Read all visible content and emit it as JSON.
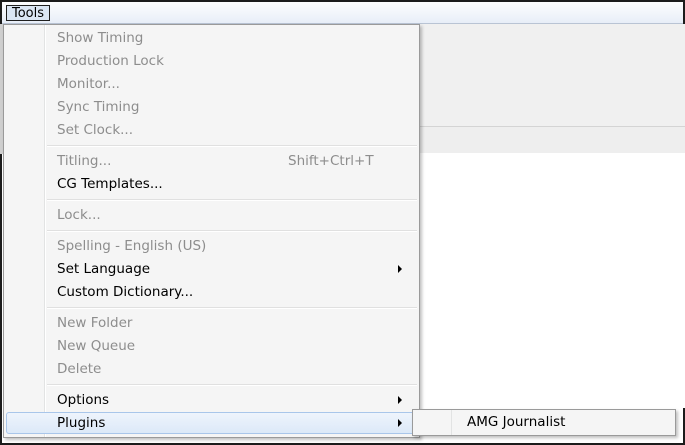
{
  "menubar": {
    "tools_label": "Tools"
  },
  "menu": {
    "show_timing": "Show Timing",
    "production_lock": "Production Lock",
    "monitor": "Monitor...",
    "sync_timing": "Sync Timing",
    "set_clock": "Set Clock...",
    "titling": "Titling...",
    "titling_shortcut": "Shift+Ctrl+T",
    "cg_templates": "CG Templates...",
    "lock": "Lock...",
    "spelling": "Spelling - English (US)",
    "set_language": "Set Language",
    "custom_dictionary": "Custom Dictionary...",
    "new_folder": "New Folder",
    "new_queue": "New Queue",
    "delete": "Delete",
    "options": "Options",
    "plugins": "Plugins"
  },
  "submenu": {
    "amg_journalist": "AMG Journalist"
  }
}
